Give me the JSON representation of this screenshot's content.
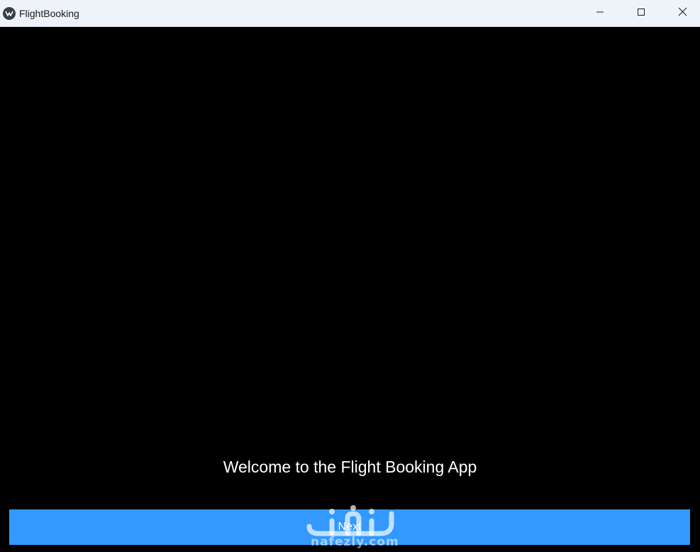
{
  "window": {
    "title": "FlightBooking",
    "icons": {
      "app": "kivy-app-icon",
      "minimize": "minimize-icon",
      "maximize": "maximize-icon",
      "close": "close-icon"
    }
  },
  "main": {
    "welcome_text": "Welcome to the Flight Booking App",
    "next_label": "Next"
  },
  "watermark": {
    "text": "nafezly.com"
  },
  "colors": {
    "titlebar_bg": "#eef3f9",
    "content_bg": "#000000",
    "button_bg": "#3399ff",
    "text": "#ffffff"
  }
}
